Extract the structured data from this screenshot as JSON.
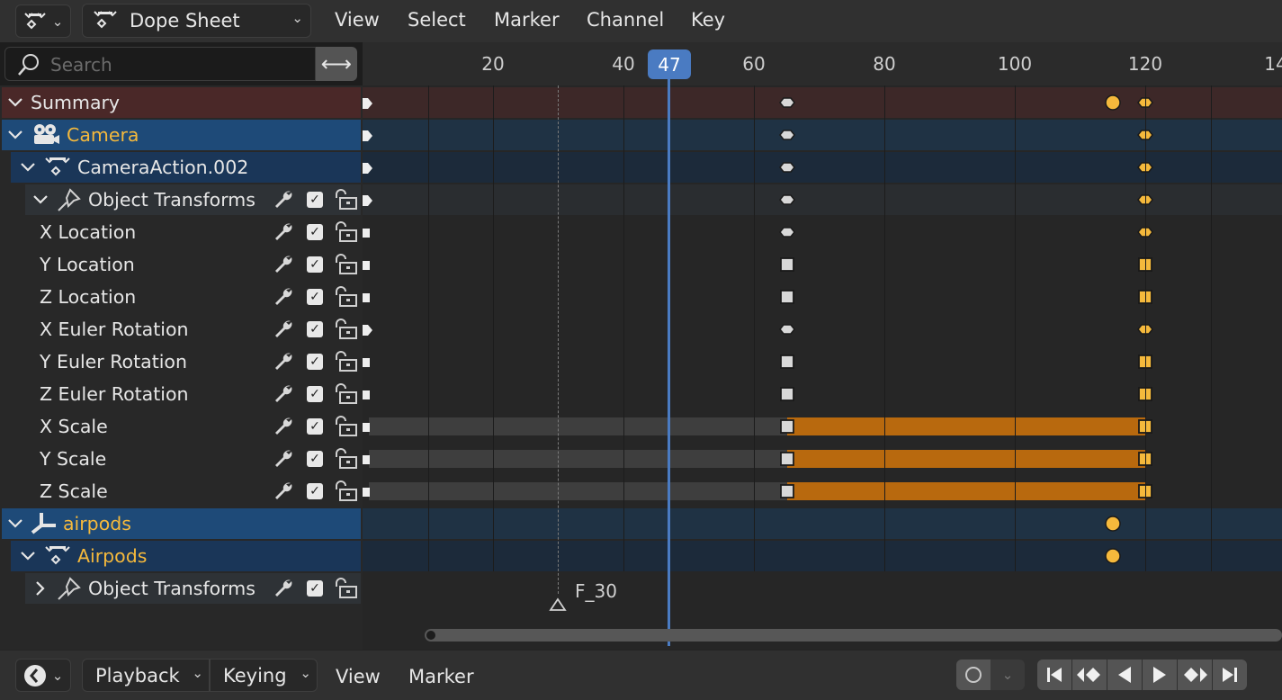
{
  "header": {
    "editor_type": "Dope Sheet",
    "menus": [
      "View",
      "Select",
      "Marker",
      "Channel",
      "Key"
    ]
  },
  "search": {
    "placeholder": "Search"
  },
  "ruler": {
    "ticks": [
      "20",
      "40",
      "60",
      "80",
      "100",
      "120",
      "14"
    ],
    "current_frame": "47"
  },
  "channels": [
    {
      "label": "Summary",
      "type": "summary"
    },
    {
      "label": "Camera",
      "type": "object"
    },
    {
      "label": "CameraAction.002",
      "type": "action"
    },
    {
      "label": "Object Transforms",
      "type": "group"
    },
    {
      "label": "X Location",
      "type": "fcurve"
    },
    {
      "label": "Y Location",
      "type": "fcurve"
    },
    {
      "label": "Z Location",
      "type": "fcurve"
    },
    {
      "label": "X Euler Rotation",
      "type": "fcurve"
    },
    {
      "label": "Y Euler Rotation",
      "type": "fcurve"
    },
    {
      "label": "Z Euler Rotation",
      "type": "fcurve"
    },
    {
      "label": "X Scale",
      "type": "fcurve"
    },
    {
      "label": "Y Scale",
      "type": "fcurve"
    },
    {
      "label": "Z Scale",
      "type": "fcurve"
    },
    {
      "label": "airpods",
      "type": "object"
    },
    {
      "label": "Airpods",
      "type": "action"
    },
    {
      "label": "Object Transforms",
      "type": "group"
    }
  ],
  "marker": {
    "label": "F_30"
  },
  "footer": {
    "menus": [
      "Playback",
      "Keying",
      "View",
      "Marker"
    ]
  },
  "colors": {
    "accent": "#4a7bc2",
    "selected_key": "#f5b93c",
    "hold_bar": "#b8690e",
    "summary_row": "#4a2a2a",
    "object_row": "#1e4a78"
  }
}
